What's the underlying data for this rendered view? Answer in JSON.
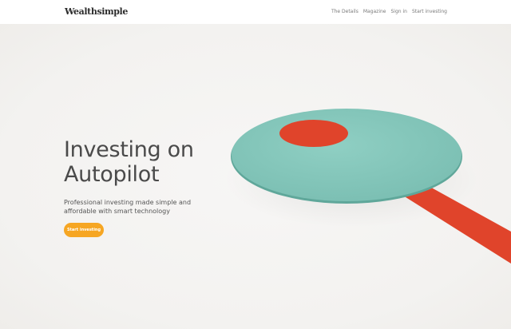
{
  "brand": {
    "logo": "Wealthsimple"
  },
  "nav": {
    "items": [
      {
        "label": "The Details"
      },
      {
        "label": "Magazine"
      },
      {
        "label": "Sign in"
      },
      {
        "label": "Start investing"
      }
    ]
  },
  "hero": {
    "title_line1": "Investing on",
    "title_line2": "Autopilot",
    "subtitle": "Professional investing made simple and affordable with smart technology",
    "cta_label": "Start investing"
  },
  "colors": {
    "accent": "#f6a623",
    "teal": "#83c4b8",
    "red": "#e0442b",
    "background": "#f5f4f2"
  }
}
